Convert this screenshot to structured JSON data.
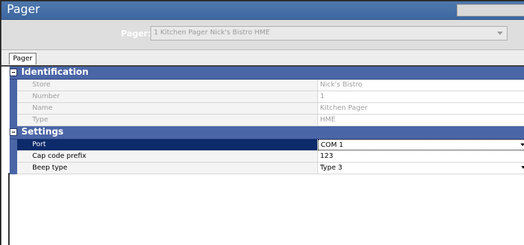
{
  "window": {
    "title": "Pager"
  },
  "selector": {
    "label": "Pager:",
    "value": "1 Kitchen Pager Nick's Bistro HME"
  },
  "tabs": [
    {
      "label": "Pager",
      "active": true
    }
  ],
  "grid": {
    "categories": [
      {
        "label": "Identification",
        "rows": [
          {
            "name": "Store",
            "value": "Nick's Bistro",
            "readonly": true
          },
          {
            "name": "Number",
            "value": "1",
            "readonly": true
          },
          {
            "name": "Name",
            "value": "Kitchen Pager",
            "readonly": true
          },
          {
            "name": "Type",
            "value": "HME",
            "readonly": true
          }
        ]
      },
      {
        "label": "Settings",
        "rows": [
          {
            "name": "Port",
            "value": "COM 1",
            "readonly": false,
            "dropdown": true,
            "selected": true
          },
          {
            "name": "Cap code prefix",
            "value": "123",
            "readonly": false
          },
          {
            "name": "Beep type",
            "value": "Type 3",
            "readonly": false,
            "dropdown": true
          }
        ]
      }
    ]
  },
  "colors": {
    "title_bar": "#3d67a1",
    "category_header": "#4b66a7",
    "selected_row": "#0d2a6b",
    "readonly_text": "#9d9d9d"
  }
}
